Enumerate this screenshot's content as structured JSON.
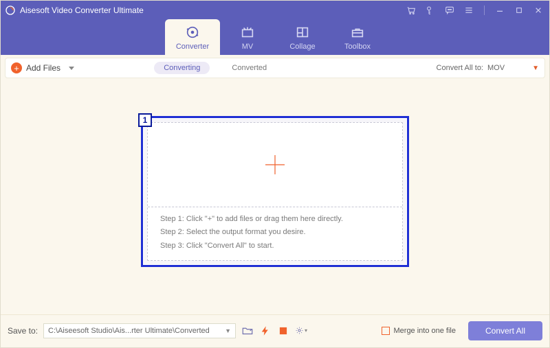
{
  "titlebar": {
    "title": "Aisesoft Video Converter Ultimate"
  },
  "tabs": [
    {
      "label": "Converter",
      "active": true
    },
    {
      "label": "MV",
      "active": false
    },
    {
      "label": "Collage",
      "active": false
    },
    {
      "label": "Toolbox",
      "active": false
    }
  ],
  "toolbar": {
    "add_files": "Add Files",
    "segments": {
      "converting": "Converting",
      "converted": "Converted",
      "active": "converting"
    },
    "convert_all_to_label": "Convert All to:",
    "format": "MOV"
  },
  "drop": {
    "badge": "1",
    "steps": [
      "Step 1: Click \"+\" to add files or drag them here directly.",
      "Step 2: Select the output format you desire.",
      "Step 3: Click \"Convert All\" to start."
    ]
  },
  "bottom": {
    "save_to_label": "Save to:",
    "path": "C:\\Aiseesoft Studio\\Ais...rter Ultimate\\Converted",
    "merge_label": "Merge into one file",
    "convert_btn": "Convert All"
  }
}
